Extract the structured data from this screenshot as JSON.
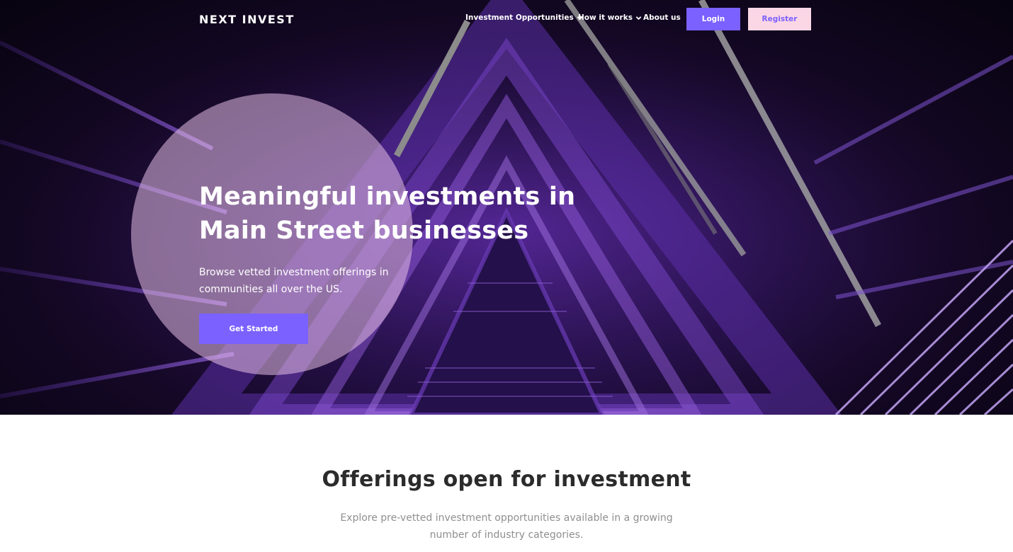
{
  "brand": "NEXT INVEST",
  "nav": {
    "investment_opportunities": "Investment Opportunities",
    "how_it_works": "How it works",
    "about_us": "About us",
    "login": "Login",
    "register": "Register"
  },
  "hero": {
    "title_line1": "Meaningful investments in",
    "title_line2": "Main Street businesses",
    "subtitle": "Browse vetted investment offerings in communities all over the US.",
    "cta": "Get Started"
  },
  "offerings": {
    "title": "Offerings open for investment",
    "subtitle": "Explore pre-vetted investment opportunities available in a growing number of industry categories."
  },
  "colors": {
    "accent": "#7b61ff",
    "register_bg": "#fbd7e6",
    "hero_bg": "#1a0b33"
  },
  "icons": [
    "chevron-down-icon"
  ]
}
